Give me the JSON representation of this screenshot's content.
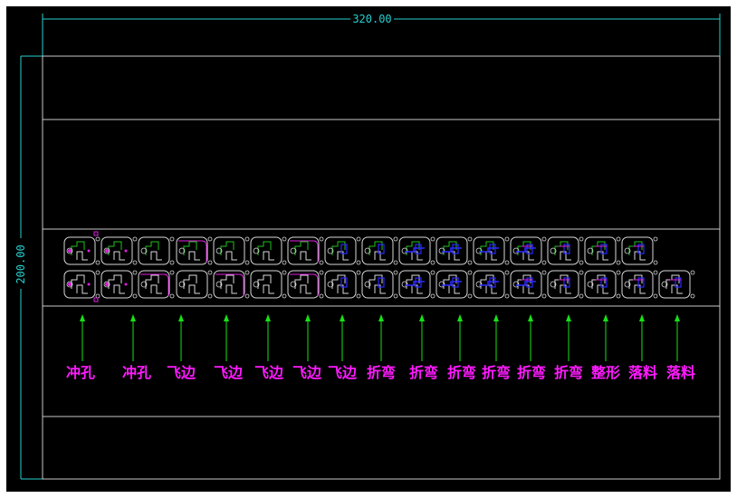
{
  "dimensions": {
    "width_label": "320.00",
    "height_label": "200.00"
  },
  "colors": {
    "background": "#000000",
    "frame_lines": "#c8c8c8",
    "dimension": "#26d0d0",
    "arrow": "#18e018",
    "label": "#ff1aff",
    "part_outline": "#d8d8d8",
    "geometry_green": "#20c020",
    "geometry_blue": "#2a2aff",
    "geometry_magenta": "#e020e0"
  },
  "stations": [
    {
      "label": "冲孔",
      "ops": "punch"
    },
    {
      "label": "冲孔",
      "ops": "punch"
    },
    {
      "label": "飞边",
      "ops": "trim"
    },
    {
      "label": "飞边",
      "ops": "trim"
    },
    {
      "label": "飞边",
      "ops": "trim"
    },
    {
      "label": "飞边",
      "ops": "trim"
    },
    {
      "label": "飞边",
      "ops": "trim"
    },
    {
      "label": "折弯",
      "ops": "bend"
    },
    {
      "label": "折弯",
      "ops": "bend"
    },
    {
      "label": "折弯",
      "ops": "bend"
    },
    {
      "label": "折弯",
      "ops": "bend"
    },
    {
      "label": "折弯",
      "ops": "bend"
    },
    {
      "label": "折弯",
      "ops": "bend"
    },
    {
      "label": "整形",
      "ops": "form"
    },
    {
      "label": "落料",
      "ops": "blank"
    },
    {
      "label": "落料",
      "ops": "blank"
    }
  ]
}
